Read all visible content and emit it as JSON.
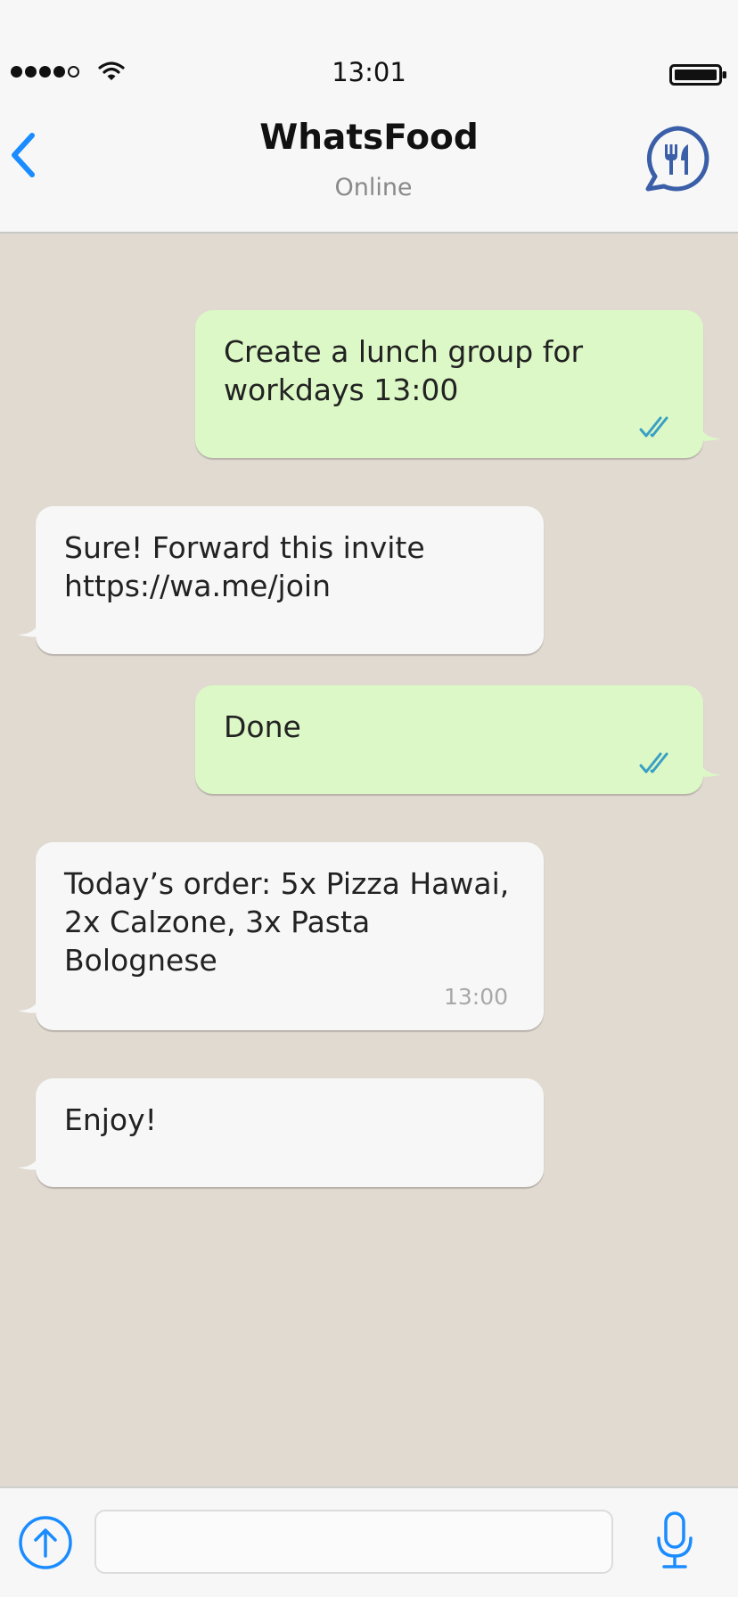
{
  "status_bar": {
    "time": "13:01",
    "signal_dots_filled": 4,
    "signal_dots_total": 5,
    "icons": [
      "signal-dots-icon",
      "wifi-icon",
      "battery-icon"
    ]
  },
  "header": {
    "title": "WhatsFood",
    "subtitle": "Online",
    "back_icon": "chevron-left-icon",
    "logo_icon": "fork-knife-chat-icon"
  },
  "messages": [
    {
      "direction": "outgoing",
      "text": "Create a lunch group for\nworkdays 13:00",
      "status_icon": "double-check-icon"
    },
    {
      "direction": "incoming",
      "text": "Sure! Forward this invite\nhttps://wa.me/join"
    },
    {
      "direction": "outgoing",
      "text": "Done",
      "status_icon": "double-check-icon"
    },
    {
      "direction": "incoming",
      "text": "Today’s order: 5x Pizza Hawai,\n2x Calzone, 3x Pasta\nBolognese",
      "time": "13:00"
    },
    {
      "direction": "incoming",
      "text": "Enjoy!"
    }
  ],
  "composer": {
    "input_value": "",
    "upload_icon": "arrow-up-circle-icon",
    "mic_icon": "microphone-icon"
  },
  "colors": {
    "accent": "#1a8cff",
    "logo_blue": "#3a5ea8",
    "chat_background": "#e1dad1",
    "outgoing_bubble": "#dcf8c6",
    "incoming_bubble": "#f7f7f7",
    "check_marks": "#3a9fc4"
  }
}
